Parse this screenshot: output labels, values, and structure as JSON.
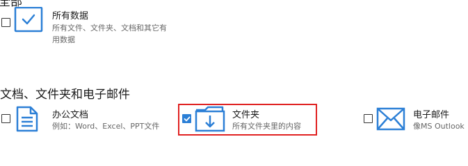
{
  "sections": {
    "top_title": "全部",
    "docs_title": "文档、文件夹和电子邮件"
  },
  "items": {
    "all_data": {
      "label": "所有数据",
      "desc_line1": "所有文件、文件夹、文档和其它有",
      "desc_line2": "用数据",
      "checked": false,
      "icon": "checkmark-square-icon"
    },
    "office_docs": {
      "label": "办公文档",
      "desc": "例如：Word、Excel、PPT文件",
      "checked": false,
      "icon": "document-icon"
    },
    "folders": {
      "label": "文件夹",
      "desc": "所有文件夹里的内容",
      "checked": true,
      "icon": "folder-download-icon"
    },
    "email": {
      "label": "电子邮件",
      "desc": "像MS Outlook",
      "checked": false,
      "icon": "envelope-icon"
    }
  },
  "colors": {
    "accent": "#2b7fd6",
    "highlight": "#e02020"
  }
}
